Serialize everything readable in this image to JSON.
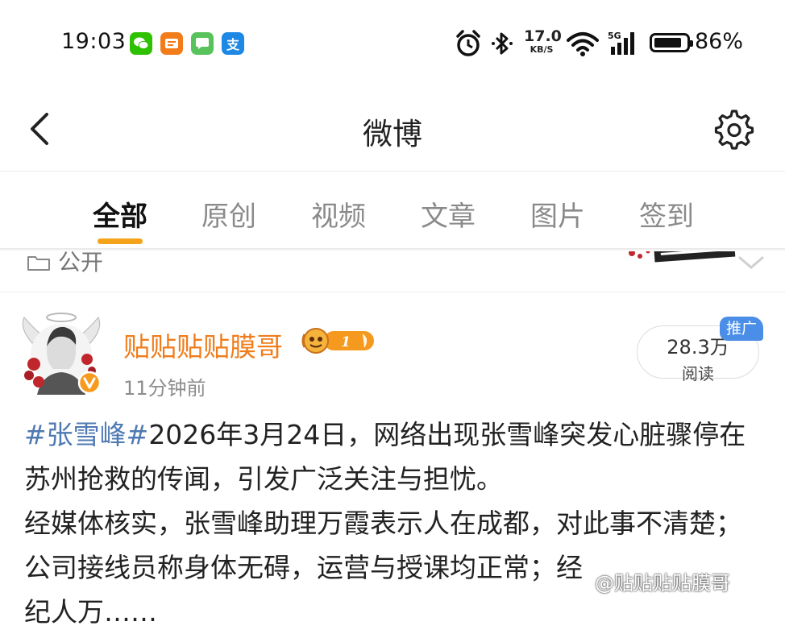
{
  "status_bar": {
    "time": "19:03",
    "apps": [
      {
        "icon": "wechat-icon",
        "color": "#2dc100"
      },
      {
        "icon": "news-icon",
        "color": "#f27c1a"
      },
      {
        "icon": "message-icon",
        "color": "#58c35a"
      },
      {
        "icon": "alipay-icon",
        "color": "#1e88e5",
        "glyph": "支"
      }
    ],
    "net_speed_value": "17.0",
    "net_speed_unit": "KB/S",
    "network": "5G",
    "battery_percent": "86%",
    "battery_level": 0.86
  },
  "header": {
    "title": "微博"
  },
  "tabs": [
    {
      "label": "全部",
      "active": true
    },
    {
      "label": "原创",
      "active": false
    },
    {
      "label": "视频",
      "active": false
    },
    {
      "label": "文章",
      "active": false
    },
    {
      "label": "图片",
      "active": false
    },
    {
      "label": "签到",
      "active": false
    }
  ],
  "previous_card": {
    "visibility": "公开"
  },
  "post": {
    "username": "贴贴贴贴膜哥",
    "level": "1",
    "time": "11分钟前",
    "read_count": "28.3万",
    "read_label": "阅读",
    "promo_tag": "推广",
    "hashtag": "#张雪峰#",
    "paragraph1": "2026年3月24日，网络出现张雪峰突发心脏骤停在苏州抢救的传闻，引发广泛关注与担忧。",
    "paragraph2": "经媒体核实，张雪峰助理万霞表示人在成都，对此事不清楚；公司接线员称身体无碍，运营与授课均正常；经",
    "paragraph3_partial": "纪人万……"
  },
  "watermark": "@贴贴贴贴膜哥",
  "colors": {
    "accent": "#f5a31a",
    "username": "#f07c1a",
    "hashtag": "#4e79b2",
    "promo": "#4a8ee8"
  }
}
